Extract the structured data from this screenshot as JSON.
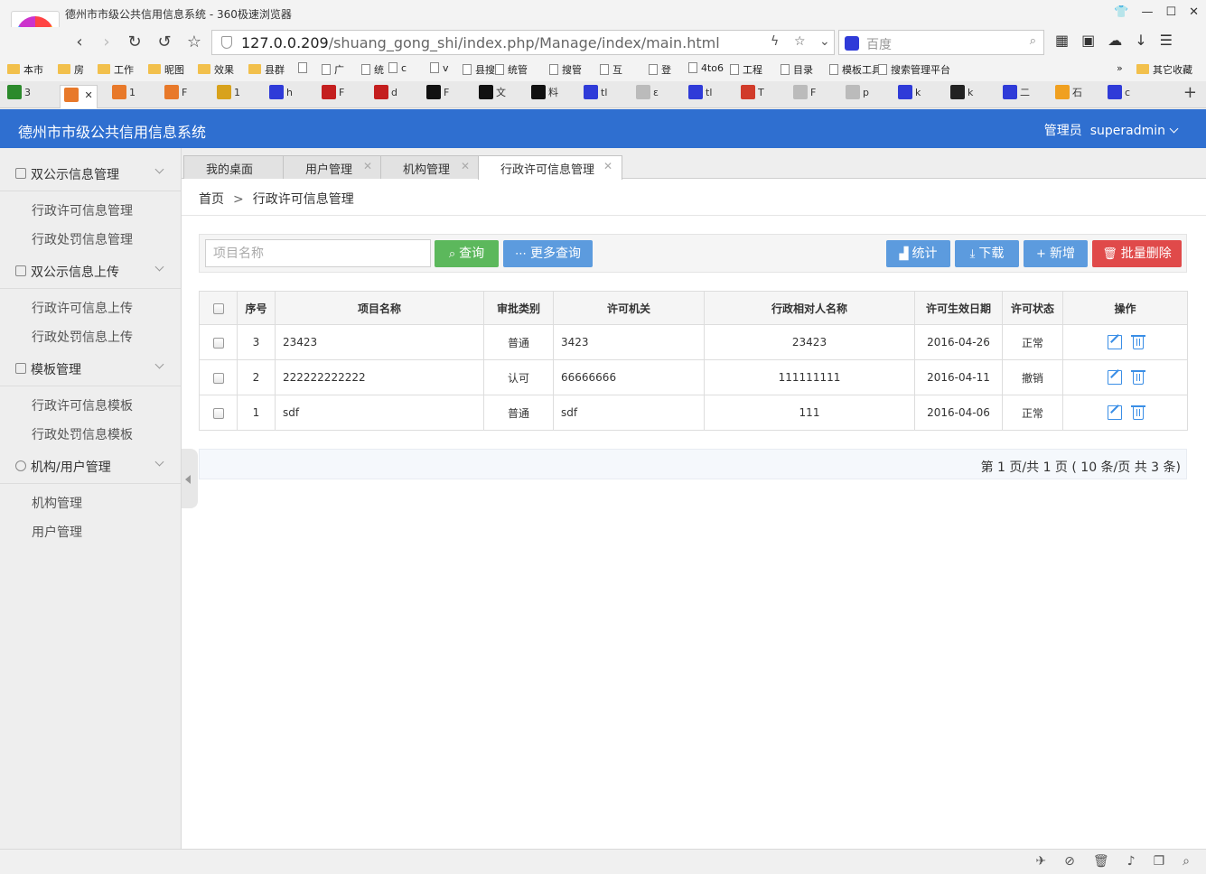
{
  "browser": {
    "window_title": "德州市市级公共信用信息系统 - 360极速浏览器",
    "url_host": "127.0.0.209",
    "url_path": "/shuang_gong_shi/index.php/Manage/index/main.html",
    "search_placeholder": "百度",
    "bookmarks": [
      "本市",
      "房",
      "工作",
      "昵图",
      "效果",
      "县群",
      "",
      "广",
      "统",
      "c",
      "v",
      "县搜",
      "统管",
      "搜管",
      "互",
      "登",
      "4to6",
      "工程",
      "目录",
      "模板工具1",
      "搜索管理平台"
    ],
    "bookmarks_more": "»",
    "bookmarks_other": "其它收藏",
    "tabs": [
      "3",
      "",
      "1",
      "F",
      "1",
      "h",
      "F",
      "d",
      "F",
      "文",
      "料",
      "tl",
      "ε",
      "tl",
      "T",
      "F",
      "p",
      "k",
      "k",
      "二",
      "石",
      "c"
    ]
  },
  "app": {
    "title": "德州市市级公共信用信息系统",
    "user_role": "管理员",
    "user_name": "superadmin"
  },
  "sidebar": {
    "groups": [
      {
        "label": "双公示信息管理",
        "items": [
          "行政许可信息管理",
          "行政处罚信息管理"
        ]
      },
      {
        "label": "双公示信息上传",
        "items": [
          "行政许可信息上传",
          "行政处罚信息上传"
        ]
      },
      {
        "label": "模板管理",
        "items": [
          "行政许可信息模板",
          "行政处罚信息模板"
        ]
      },
      {
        "label": "机构/用户管理",
        "items": [
          "机构管理",
          "用户管理"
        ]
      }
    ]
  },
  "content_tabs": [
    "我的桌面",
    "用户管理",
    "机构管理",
    "行政许可信息管理"
  ],
  "breadcrumb": {
    "home": "首页",
    "sep": ">",
    "current": "行政许可信息管理"
  },
  "toolbar": {
    "search_placeholder": "项目名称",
    "query_label": "查询",
    "more_query_label": "更多查询",
    "stats_label": "统计",
    "download_label": "下载",
    "add_label": "新增",
    "batch_delete_label": "批量删除"
  },
  "table": {
    "headers": [
      "序号",
      "项目名称",
      "审批类别",
      "许可机关",
      "行政相对人名称",
      "许可生效日期",
      "许可状态",
      "操作"
    ],
    "rows": [
      {
        "no": "3",
        "name": "23423",
        "category": "普通",
        "authority": "3423",
        "party": "23423",
        "date": "2016-04-26",
        "status": "正常"
      },
      {
        "no": "2",
        "name": "222222222222",
        "category": "认可",
        "authority": "66666666",
        "party": "111111111",
        "date": "2016-04-11",
        "status": "撤销"
      },
      {
        "no": "1",
        "name": "sdf",
        "category": "普通",
        "authority": "sdf",
        "party": "111",
        "date": "2016-04-06",
        "status": "正常"
      }
    ]
  },
  "pager": {
    "text": "第 1 页/共 1 页 ( 10 条/页 共 3 条)"
  },
  "colors": {
    "header_blue": "#2f6fd0",
    "query_green": "#5cb85c",
    "action_blue": "#5c9bde",
    "delete_red": "#e04a4a"
  },
  "icons": [
    "back-icon",
    "forward-icon",
    "refresh-icon",
    "undo-icon",
    "star-icon",
    "search-icon",
    "stats-icon",
    "download-icon",
    "plus-icon",
    "trash-icon",
    "edit-icon",
    "delete-icon"
  ]
}
